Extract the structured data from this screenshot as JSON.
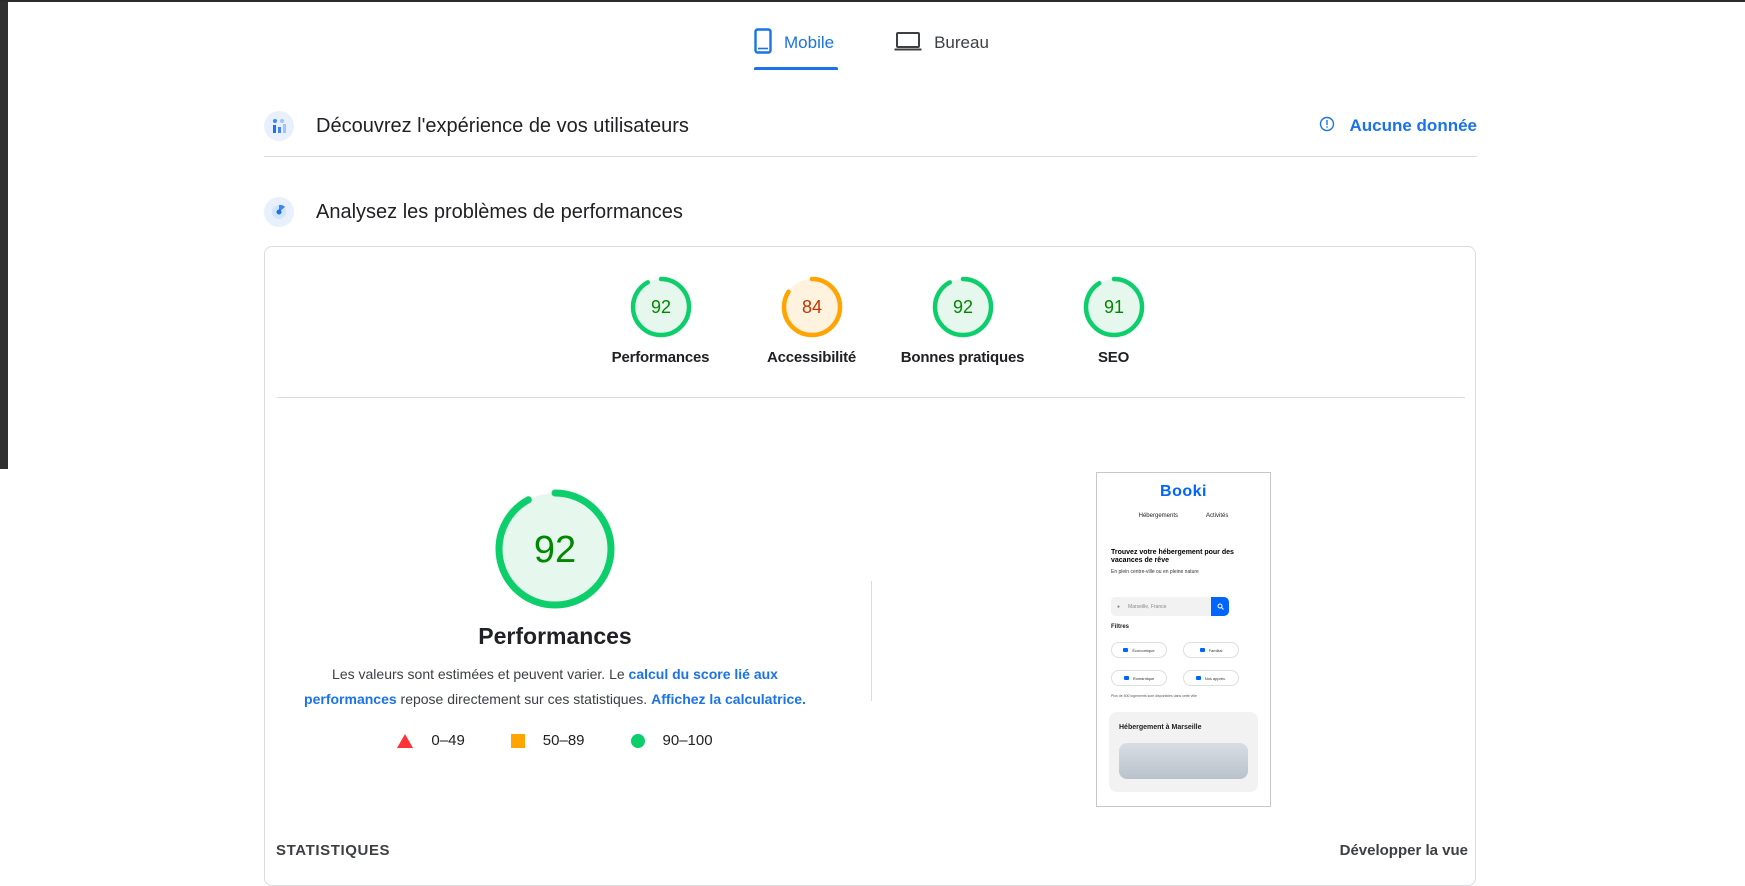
{
  "tabs": [
    {
      "label": "Mobile",
      "icon": "phone-icon",
      "active": true
    },
    {
      "label": "Bureau",
      "icon": "laptop-icon",
      "active": false
    }
  ],
  "sections": {
    "field": {
      "title": "Découvrez l'expérience de vos utilisateurs",
      "icon": "users-chart-icon",
      "status": "Aucune donnée",
      "status_icon": "info-icon"
    },
    "lab": {
      "title": "Analysez les problèmes de performances",
      "icon": "radar-icon"
    }
  },
  "gauges": [
    {
      "label": "Performances",
      "score": 92,
      "color": "#0cce6b",
      "text_color": "#008800",
      "fill": "#e6f8ee"
    },
    {
      "label": "Accessibilité",
      "score": 84,
      "color": "#ffa400",
      "text_color": "#c33300",
      "fill": "#fff3e0"
    },
    {
      "label": "Bonnes pratiques",
      "score": 92,
      "color": "#0cce6b",
      "text_color": "#008800",
      "fill": "#e6f8ee"
    },
    {
      "label": "SEO",
      "score": 91,
      "color": "#0cce6b",
      "text_color": "#008800",
      "fill": "#e6f8ee"
    }
  ],
  "main_gauge": {
    "score": 92,
    "title": "Performances"
  },
  "description": {
    "part1": "Les valeurs sont estimées et peuvent varier. Le ",
    "link1": "calcul du score lié aux performances",
    "part2": " repose directement sur ces statistiques. ",
    "link2": "Affichez la calculatrice."
  },
  "legend": [
    {
      "range": "0–49",
      "shape": "triangle",
      "color": "#ff3333"
    },
    {
      "range": "50–89",
      "shape": "square",
      "color": "#ffa400"
    },
    {
      "range": "90–100",
      "shape": "circle",
      "color": "#0cce6b"
    }
  ],
  "screenshot": {
    "logo": "Booki",
    "nav": [
      "Hébergements",
      "Activités"
    ],
    "headline": "Trouvez votre hébergement pour des vacances de rêve",
    "subline": "En plein centre-ville ou en pleine nature",
    "search_placeholder": "Marseille, France",
    "filters_label": "Filtres",
    "chips": [
      "Économique",
      "Familial",
      "Romantique",
      "Nos appréc."
    ],
    "note": "Plus de 500 logements sont disponibles dans cette ville",
    "panel_title": "Hébergement à Marseille"
  },
  "footer": {
    "left": "STATISTIQUES",
    "right": "Développer la vue"
  }
}
